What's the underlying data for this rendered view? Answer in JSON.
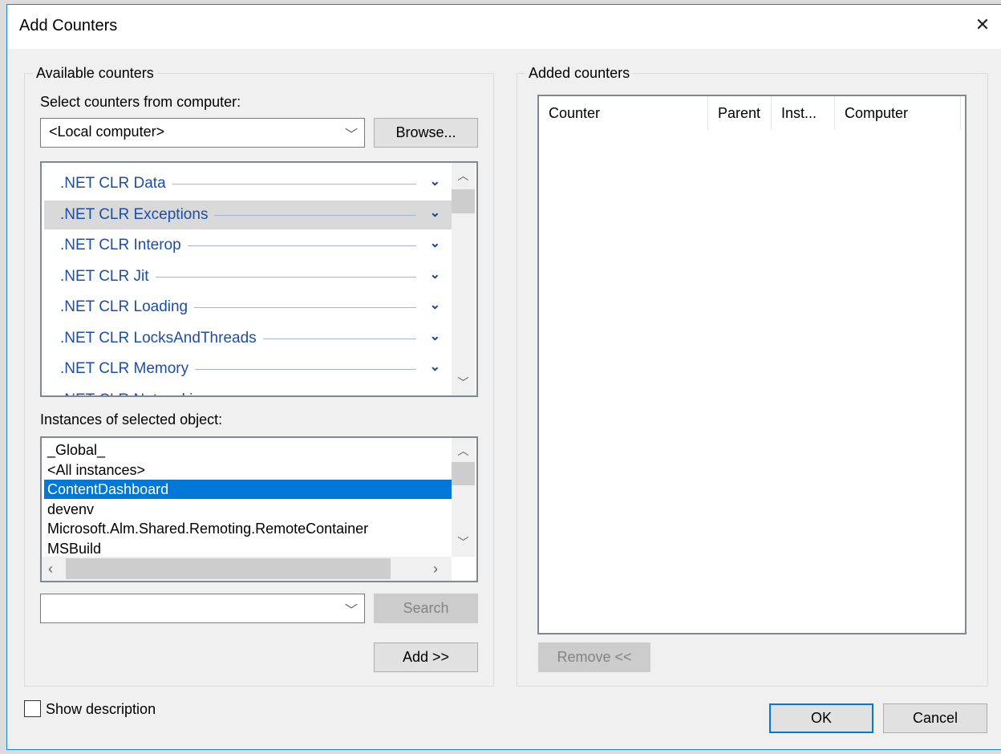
{
  "dialog": {
    "title": "Add Counters",
    "close_icon": "close-icon"
  },
  "available": {
    "legend": "Available counters",
    "computer_label": "Select counters from computer:",
    "computer_value": "<Local computer>",
    "browse_label": "Browse...",
    "counters": [
      ".NET CLR Data",
      ".NET CLR Exceptions",
      ".NET CLR Interop",
      ".NET CLR Jit",
      ".NET CLR Loading",
      ".NET CLR LocksAndThreads",
      ".NET CLR Memory",
      ".NET CLR Networking"
    ],
    "selected_counter": ".NET CLR Exceptions",
    "instances_label": "Instances of selected object:",
    "instances": [
      "_Global_",
      "<All instances>",
      "ContentDashboard",
      "devenv",
      "Microsoft.Alm.Shared.Remoting.RemoteContainer",
      "MSBuild"
    ],
    "selected_instance": "ContentDashboard",
    "search_value": "",
    "search_label": "Search",
    "add_label": "Add >>"
  },
  "added": {
    "legend": "Added counters",
    "columns": [
      "Counter",
      "Parent",
      "Inst...",
      "Computer"
    ],
    "remove_label": "Remove <<"
  },
  "footer": {
    "show_description": "Show description",
    "show_description_checked": false,
    "ok_label": "OK",
    "cancel_label": "Cancel"
  },
  "colors": {
    "accent": "#0078d7",
    "counter_text": "#1c4ea6",
    "selected_row_gray": "#d9d9d9"
  }
}
